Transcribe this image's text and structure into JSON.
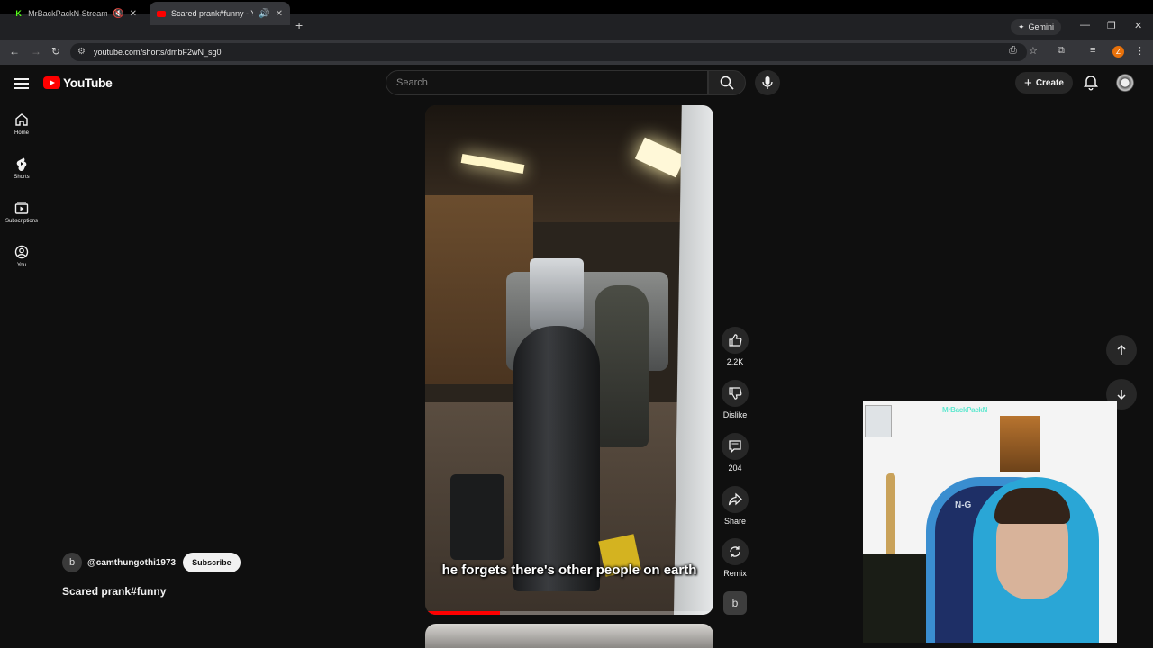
{
  "browser": {
    "tabs": [
      {
        "title": "MrBackPackN Stream - Wat",
        "favicon": "K",
        "active": false
      },
      {
        "title": "Scared prank#funny - YouT",
        "favicon": "yt",
        "active": true
      }
    ],
    "gemini_label": "Gemini",
    "url": "youtube.com/shorts/dmbF2wN_sg0",
    "profile_letter": "Z"
  },
  "youtube": {
    "logo_text": "YouTube",
    "search_placeholder": "Search",
    "create_label": "Create",
    "sidebar": [
      {
        "label": "Home",
        "icon": "home-icon"
      },
      {
        "label": "Shorts",
        "icon": "shorts-icon"
      },
      {
        "label": "Subscriptions",
        "icon": "subscriptions-icon"
      },
      {
        "label": "You",
        "icon": "you-icon"
      }
    ]
  },
  "short": {
    "caption": "he forgets there's other people on earth",
    "progress": 0.26,
    "channel_initial": "b",
    "channel_handle": "@camthungothi1973",
    "subscribe_label": "Subscribe",
    "title": "Scared prank#funny",
    "actions": {
      "likes": "2.2K",
      "dislike": "Dislike",
      "comments": "204",
      "share": "Share",
      "remix": "Remix"
    }
  },
  "overlay": {
    "tag": "MrBackPackN",
    "chair_label": "N-G"
  },
  "colors": {
    "brand_red": "#ff0000",
    "background": "#0f0f0f",
    "accent_orange": "#e8710a"
  }
}
